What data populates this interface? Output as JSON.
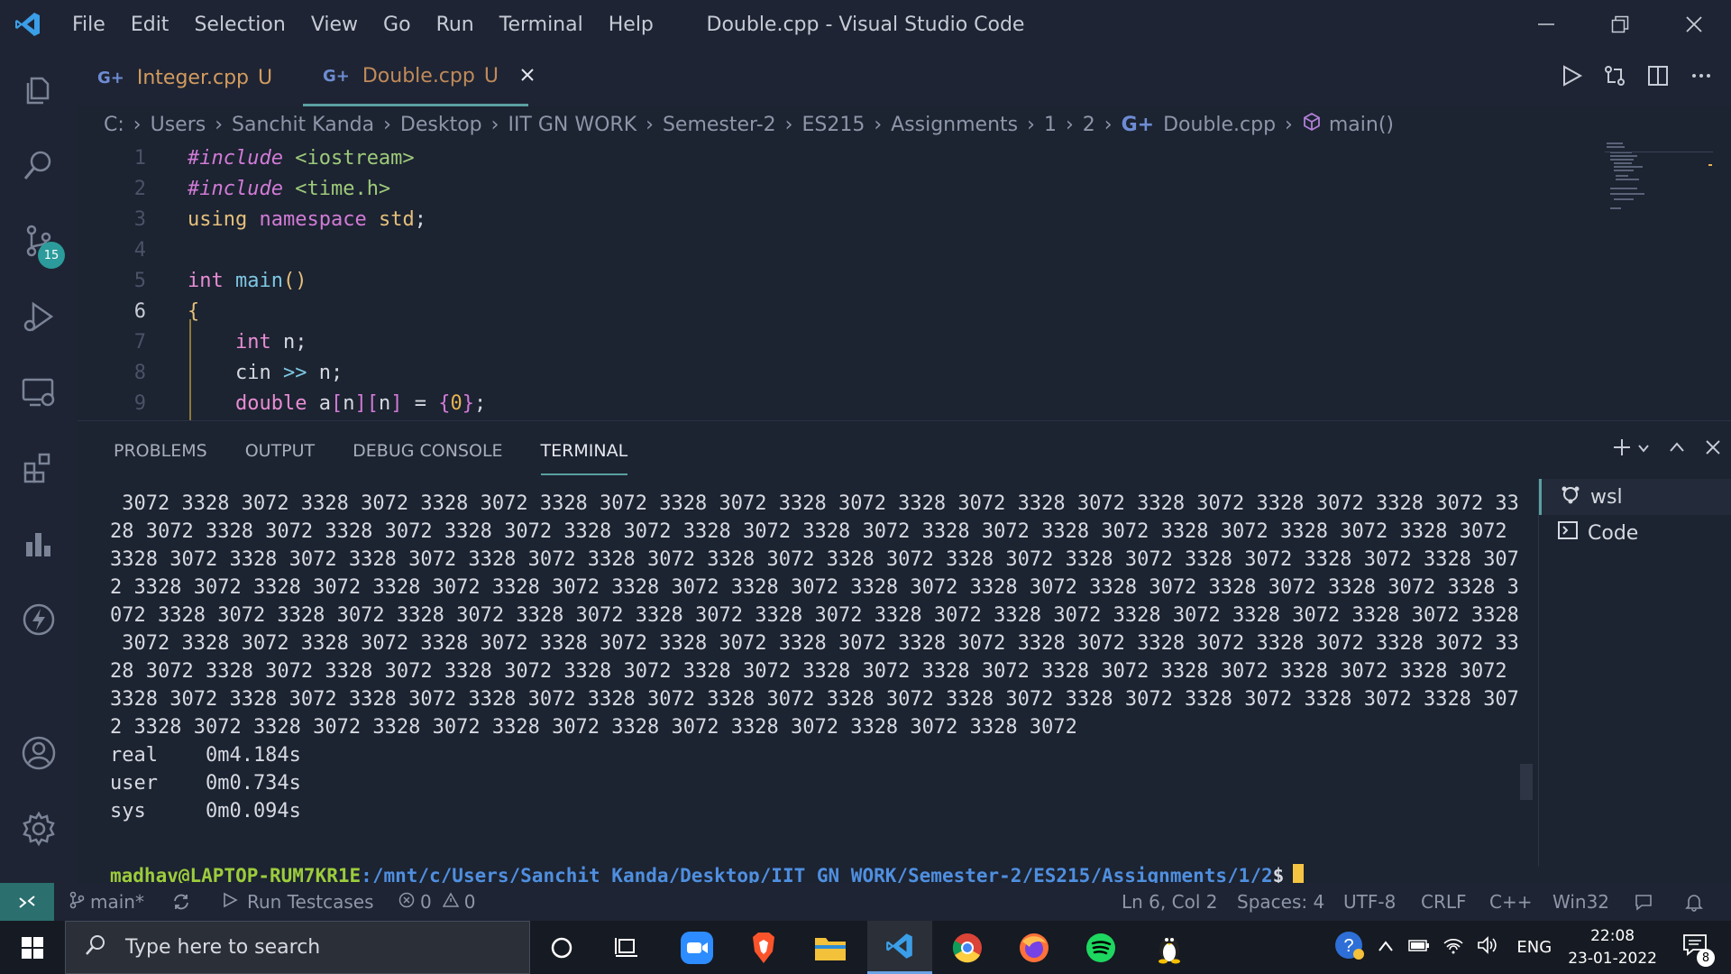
{
  "window": {
    "title": "Double.cpp - Visual Studio Code",
    "menu": [
      "File",
      "Edit",
      "Selection",
      "View",
      "Go",
      "Run",
      "Terminal",
      "Help"
    ]
  },
  "activity": {
    "source_control_badge": "15"
  },
  "tabs": [
    {
      "label": "Integer.cpp",
      "status": "U",
      "icon": "G+"
    },
    {
      "label": "Double.cpp",
      "status": "U",
      "icon": "G+"
    }
  ],
  "breadcrumb": [
    "C:",
    "Users",
    "Sanchit Kanda",
    "Desktop",
    "IIT GN WORK",
    "Semester-2",
    "ES215",
    "Assignments",
    "1",
    "2",
    "Double.cpp",
    "main()"
  ],
  "code": {
    "line_numbers": [
      "1",
      "2",
      "3",
      "4",
      "5",
      "6",
      "7",
      "8",
      "9"
    ],
    "current_line": "6"
  },
  "panel": {
    "tabs": [
      "PROBLEMS",
      "OUTPUT",
      "DEBUG CONSOLE",
      "TERMINAL"
    ],
    "active_tab": "TERMINAL",
    "terminal_lines": [
      " 3072 3328 3072 3328 3072 3328 3072 3328 3072 3328 3072 3328 3072 3328 3072 3328 3072 3328 3072 3328 3072 3328 3072 33",
      "28 3072 3328 3072 3328 3072 3328 3072 3328 3072 3328 3072 3328 3072 3328 3072 3328 3072 3328 3072 3328 3072 3328 3072",
      "3328 3072 3328 3072 3328 3072 3328 3072 3328 3072 3328 3072 3328 3072 3328 3072 3328 3072 3328 3072 3328 3072 3328 307",
      "2 3328 3072 3328 3072 3328 3072 3328 3072 3328 3072 3328 3072 3328 3072 3328 3072 3328 3072 3328 3072 3328 3072 3328 3",
      "072 3328 3072 3328 3072 3328 3072 3328 3072 3328 3072 3328 3072 3328 3072 3328 3072 3328 3072 3328 3072 3328 3072 3328",
      " 3072 3328 3072 3328 3072 3328 3072 3328 3072 3328 3072 3328 3072 3328 3072 3328 3072 3328 3072 3328 3072 3328 3072 33",
      "28 3072 3328 3072 3328 3072 3328 3072 3328 3072 3328 3072 3328 3072 3328 3072 3328 3072 3328 3072 3328 3072 3328 3072",
      "3328 3072 3328 3072 3328 3072 3328 3072 3328 3072 3328 3072 3328 3072 3328 3072 3328 3072 3328 3072 3328 3072 3328 307",
      "2 3328 3072 3328 3072 3328 3072 3328 3072 3328 3072 3328 3072 3328 3072 3328 3072",
      "",
      "real    0m4.184s",
      "user    0m0.734s",
      "sys     0m0.094s"
    ],
    "prompt_user": "madhav@LAPTOP-RUM7KR1E",
    "prompt_path": ":/mnt/c/Users/Sanchit Kanda/Desktop/IIT GN WORK/Semester-2/ES215/Assignments/1/2",
    "prompt_symbol": "$",
    "terminals": [
      "wsl",
      "Code"
    ]
  },
  "statusbar": {
    "branch": "main*",
    "run_testcases": "Run Testcases",
    "errors": "0",
    "warnings": "0",
    "position": "Ln 6, Col 2",
    "spaces": "Spaces: 4",
    "encoding": "UTF-8",
    "eol": "CRLF",
    "language": "C++",
    "platform": "Win32"
  },
  "taskbar": {
    "search_placeholder": "Type here to search",
    "lang": "ENG",
    "time": "22:08",
    "date": "23-01-2022",
    "notifications": "8"
  },
  "colors": {
    "accent": "#5aa0a0",
    "bg": "#1c2331"
  }
}
